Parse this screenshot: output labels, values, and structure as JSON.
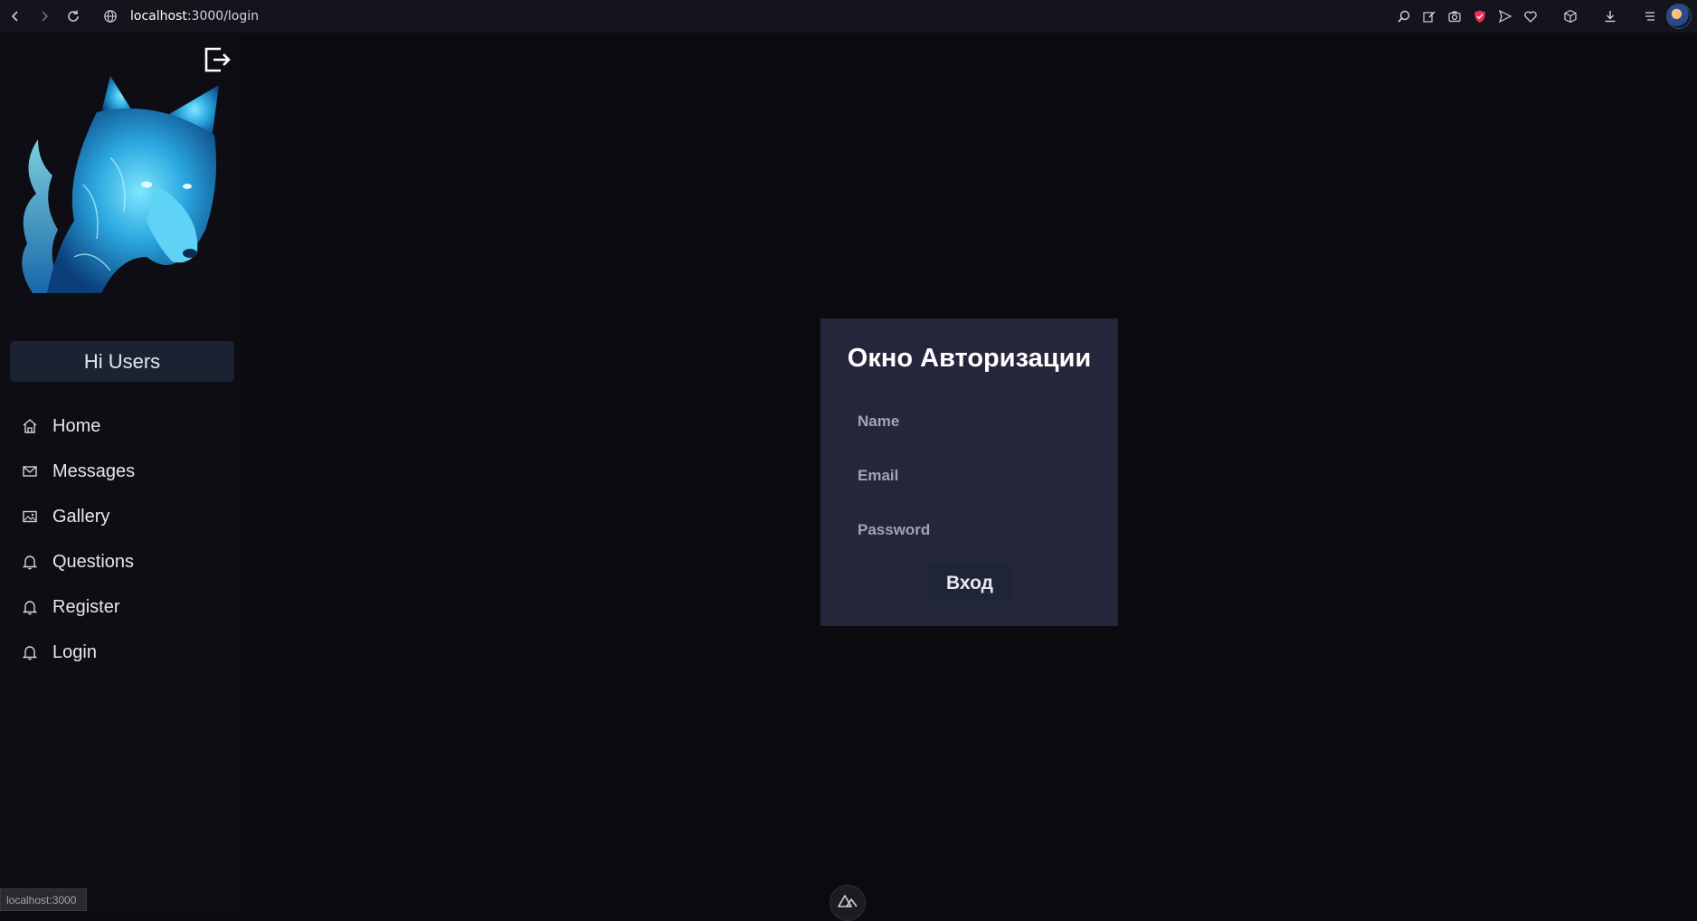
{
  "browser": {
    "url_host": "localhost",
    "url_rest": ":3000/login",
    "toolbar_icons": [
      "zoom-icon",
      "edit-icon",
      "camera-icon",
      "shield-icon",
      "send-icon",
      "heart-icon",
      "cube-icon",
      "download-icon",
      "menu-icon",
      "profile-avatar"
    ]
  },
  "sidebar": {
    "greeting": "Hi Users",
    "items": [
      {
        "label": "Home",
        "icon": "home-icon"
      },
      {
        "label": "Messages",
        "icon": "mail-icon"
      },
      {
        "label": "Gallery",
        "icon": "image-icon"
      },
      {
        "label": "Questions",
        "icon": "bell-icon"
      },
      {
        "label": "Register",
        "icon": "bell-icon"
      },
      {
        "label": "Login",
        "icon": "bell-icon"
      }
    ]
  },
  "login": {
    "title": "Окно Авторизации",
    "name_placeholder": "Name",
    "email_placeholder": "Email",
    "password_placeholder": "Password",
    "submit_label": "Вход"
  },
  "status_tip": "localhost:3000",
  "colors": {
    "background": "#0a0a0f",
    "sidebar": "#0d0d13",
    "card": "#25253b",
    "greeting_bg": "#1b2232",
    "accent_wolf": "#38bdf8"
  }
}
